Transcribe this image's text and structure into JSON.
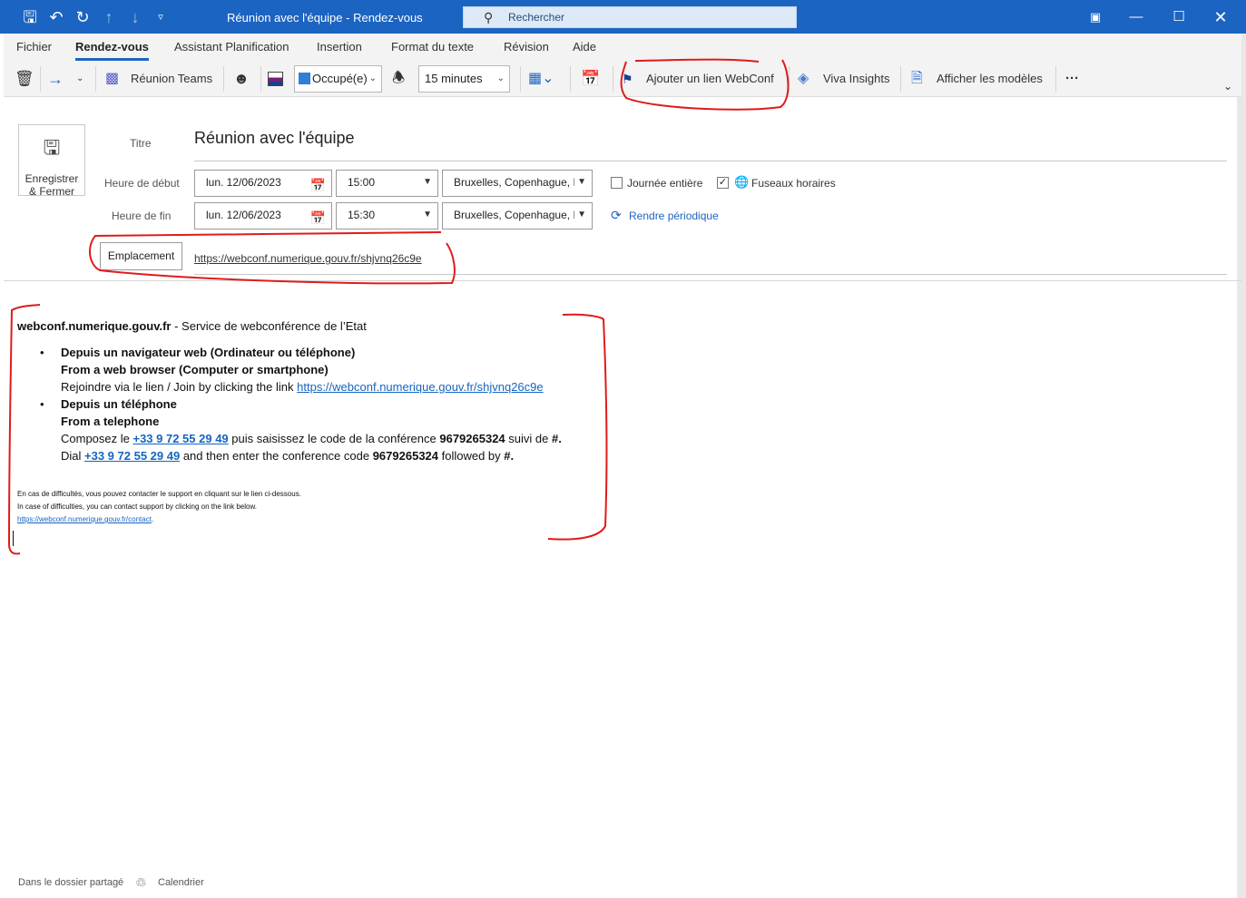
{
  "window": {
    "title": "Réunion avec l'équipe  -  Rendez-vous",
    "search_placeholder": "Rechercher"
  },
  "menu_tabs": [
    "Fichier",
    "Rendez-vous",
    "Assistant Planification",
    "Insertion",
    "Format du texte",
    "Révision",
    "Aide"
  ],
  "ribbon": {
    "teams_label": "Réunion Teams",
    "status_value": "Occupé(e)",
    "reminder_value": "15 minutes",
    "webconf_label": "Ajouter un lien WebConf",
    "viva_label": "Viva Insights",
    "templates_label": "Afficher les modèles",
    "more_label": "···"
  },
  "form": {
    "save_label_1": "Enregistrer",
    "save_label_2": "& Fermer",
    "title_label": "Titre",
    "title_value": "Réunion avec l'équipe",
    "start_label": "Heure de début",
    "start_date": "lun. 12/06/2023",
    "start_time": "15:00",
    "start_tz": "Bruxelles, Copenhague, I",
    "allday_label": "Journée entière",
    "timezones_label": "Fuseaux horaires",
    "end_label": "Heure de fin",
    "end_date": "lun. 12/06/2023",
    "end_time": "15:30",
    "end_tz": "Bruxelles, Copenhague, I",
    "recurring_label": "Rendre périodique",
    "location_button": "Emplacement",
    "location_value": "https://webconf.numerique.gouv.fr/shjvnq26c9e"
  },
  "body": {
    "site": "webconf.numerique.gouv.fr",
    "site_desc": " - Service de webconférence de l’Etat",
    "b1_line1": "Depuis un navigateur web (Ordinateur ou téléphone)",
    "b1_line2": "From a web browser (Computer or smartphone)",
    "b1_line3": "Rejoindre via le lien / Join by clicking the link ",
    "b1_link": "https://webconf.numerique.gouv.fr/shjvnq26c9e",
    "b2_line1": "Depuis un téléphone",
    "b2_line2": "From a telephone",
    "fr_pre": "Composez le ",
    "phone": "+33 9 72 55 29 49",
    "fr_mid": " puis saisissez le code de la conférence ",
    "code": "9679265324",
    "fr_post": " suivi de ",
    "hash": "#.",
    "en_pre": "Dial ",
    "en_mid": " and then enter the conference code ",
    "en_post": " followed by ",
    "help_fr": "En cas de difficultés, vous pouvez contacter le support en cliquant sur le lien ci-dessous.",
    "help_en": "In case of difficulties, you can contact support by clicking on the link below.",
    "help_link": "https://webconf.numerique.gouv.fr/contact",
    "help_dot": "."
  },
  "footer": {
    "folder": "Dans le dossier partagé",
    "calendar": "Calendrier"
  },
  "colors": {
    "accent": "#1b64c2",
    "annotation": "#e01b1b"
  }
}
